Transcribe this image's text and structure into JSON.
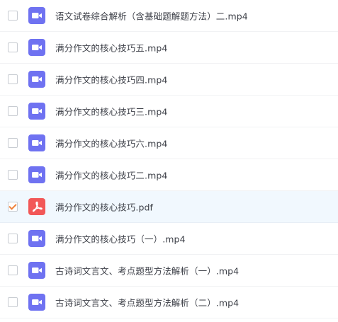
{
  "colors": {
    "video_icon": "#6f72f1",
    "pdf_icon": "#f25757",
    "selected_row_bg": "#f1f8fe",
    "checkmark": "#f0823a",
    "text": "#3c3f47"
  },
  "files": [
    {
      "name": "语文试卷综合解析（含基础题解题方法）二.mp4",
      "type": "video",
      "icon": "video-icon",
      "checked": false
    },
    {
      "name": "满分作文的核心技巧五.mp4",
      "type": "video",
      "icon": "video-icon",
      "checked": false
    },
    {
      "name": "满分作文的核心技巧四.mp4",
      "type": "video",
      "icon": "video-icon",
      "checked": false
    },
    {
      "name": "满分作文的核心技巧三.mp4",
      "type": "video",
      "icon": "video-icon",
      "checked": false
    },
    {
      "name": "满分作文的核心技巧六.mp4",
      "type": "video",
      "icon": "video-icon",
      "checked": false
    },
    {
      "name": "满分作文的核心技巧二.mp4",
      "type": "video",
      "icon": "video-icon",
      "checked": false
    },
    {
      "name": "满分作文的核心技巧.pdf",
      "type": "pdf",
      "icon": "pdf-icon",
      "checked": true
    },
    {
      "name": "满分作文的核心技巧（一）.mp4",
      "type": "video",
      "icon": "video-icon",
      "checked": false
    },
    {
      "name": "古诗词文言文、考点题型方法解析（一）.mp4",
      "type": "video",
      "icon": "video-icon",
      "checked": false
    },
    {
      "name": "古诗词文言文、考点题型方法解析（二）.mp4",
      "type": "video",
      "icon": "video-icon",
      "checked": false
    }
  ]
}
